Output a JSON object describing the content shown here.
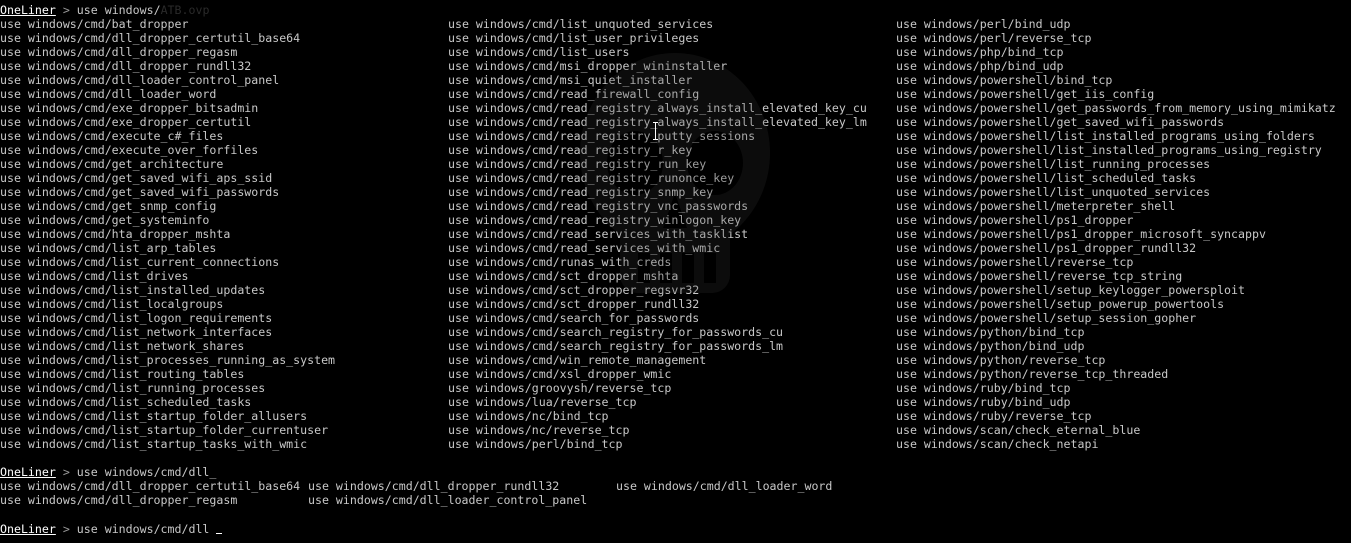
{
  "prompt": {
    "name": "OneLiner",
    "arrow": " > "
  },
  "first_command": {
    "typed": "use windows/",
    "ghost_suggestion": "ATB.ovp"
  },
  "list1": {
    "col1": [
      "use windows/cmd/bat_dropper",
      "use windows/cmd/dll_dropper_certutil_base64",
      "use windows/cmd/dll_dropper_regasm",
      "use windows/cmd/dll_dropper_rundll32",
      "use windows/cmd/dll_loader_control_panel",
      "use windows/cmd/dll_loader_word",
      "use windows/cmd/exe_dropper_bitsadmin",
      "use windows/cmd/exe_dropper_certutil",
      "use windows/cmd/execute_c#_files",
      "use windows/cmd/execute_over_forfiles",
      "use windows/cmd/get_architecture",
      "use windows/cmd/get_saved_wifi_aps_ssid",
      "use windows/cmd/get_saved_wifi_passwords",
      "use windows/cmd/get_snmp_config",
      "use windows/cmd/get_systeminfo",
      "use windows/cmd/hta_dropper_mshta",
      "use windows/cmd/list_arp_tables",
      "use windows/cmd/list_current_connections",
      "use windows/cmd/list_drives",
      "use windows/cmd/list_installed_updates",
      "use windows/cmd/list_localgroups",
      "use windows/cmd/list_logon_requirements",
      "use windows/cmd/list_network_interfaces",
      "use windows/cmd/list_network_shares",
      "use windows/cmd/list_processes_running_as_system",
      "use windows/cmd/list_routing_tables",
      "use windows/cmd/list_running_processes",
      "use windows/cmd/list_scheduled_tasks",
      "use windows/cmd/list_startup_folder_allusers",
      "use windows/cmd/list_startup_folder_currentuser",
      "use windows/cmd/list_startup_tasks_with_wmic"
    ],
    "col2": [
      "use windows/cmd/list_unquoted_services",
      "use windows/cmd/list_user_privileges",
      "use windows/cmd/list_users",
      "use windows/cmd/msi_dropper_wininstaller",
      "use windows/cmd/msi_quiet_installer",
      "use windows/cmd/read_firewall_config",
      "use windows/cmd/read_registry_always_install_elevated_key_cu",
      "use windows/cmd/read_registry_always_install_elevated_key_lm",
      "use windows/cmd/read_registry_putty_sessions",
      "use windows/cmd/read_registry_r_key",
      "use windows/cmd/read_registry_run_key",
      "use windows/cmd/read_registry_runonce_key",
      "use windows/cmd/read_registry_snmp_key",
      "use windows/cmd/read_registry_vnc_passwords",
      "use windows/cmd/read_registry_winlogon_key",
      "use windows/cmd/read_services_with_tasklist",
      "use windows/cmd/read_services_with_wmic",
      "use windows/cmd/runas_with_creds",
      "use windows/cmd/sct_dropper_mshta",
      "use windows/cmd/sct_dropper_regsvr32",
      "use windows/cmd/sct_dropper_rundll32",
      "use windows/cmd/search_for_passwords",
      "use windows/cmd/search_registry_for_passwords_cu",
      "use windows/cmd/search_registry_for_passwords_lm",
      "use windows/cmd/win_remote_management",
      "use windows/cmd/xsl_dropper_wmic",
      "use windows/groovysh/reverse_tcp",
      "use windows/lua/reverse_tcp",
      "use windows/nc/bind_tcp",
      "use windows/nc/reverse_tcp",
      "use windows/perl/bind_tcp"
    ],
    "col3": [
      "use windows/perl/bind_udp",
      "use windows/perl/reverse_tcp",
      "use windows/php/bind_tcp",
      "use windows/php/bind_udp",
      "use windows/powershell/bind_tcp",
      "use windows/powershell/get_iis_config",
      "use windows/powershell/get_passwords_from_memory_using_mimikatz",
      "use windows/powershell/get_saved_wifi_passwords",
      "use windows/powershell/list_installed_programs_using_folders",
      "use windows/powershell/list_installed_programs_using_registry",
      "use windows/powershell/list_running_processes",
      "use windows/powershell/list_scheduled_tasks",
      "use windows/powershell/list_unquoted_services",
      "use windows/powershell/meterpreter_shell",
      "use windows/powershell/ps1_dropper",
      "use windows/powershell/ps1_dropper_microsoft_syncappv",
      "use windows/powershell/ps1_dropper_rundll32",
      "use windows/powershell/reverse_tcp",
      "use windows/powershell/reverse_tcp_string",
      "use windows/powershell/setup_keylogger_powersploit",
      "use windows/powershell/setup_powerup_powertools",
      "use windows/powershell/setup_session_gopher",
      "use windows/python/bind_tcp",
      "use windows/python/bind_udp",
      "use windows/python/reverse_tcp",
      "use windows/python/reverse_tcp_threaded",
      "use windows/ruby/bind_tcp",
      "use windows/ruby/bind_udp",
      "use windows/ruby/reverse_tcp",
      "use windows/scan/check_eternal_blue",
      "use windows/scan/check_netapi"
    ]
  },
  "second_command": {
    "typed": "use windows/cmd/dll_"
  },
  "list2": {
    "col1": [
      "use windows/cmd/dll_dropper_certutil_base64",
      "use windows/cmd/dll_dropper_regasm"
    ],
    "col2": [
      "use windows/cmd/dll_dropper_rundll32",
      "use windows/cmd/dll_loader_control_panel"
    ],
    "col3": [
      "use windows/cmd/dll_loader_word"
    ]
  },
  "third_command": {
    "typed": "use windows/cmd/dll_"
  },
  "colors": {
    "background": "#000000",
    "text": "#c8c8c8",
    "prompt": "#ffffff"
  },
  "icons": {
    "watermark": "skull-watermark-icon",
    "pointer": "text-cursor-ibeam-icon"
  }
}
